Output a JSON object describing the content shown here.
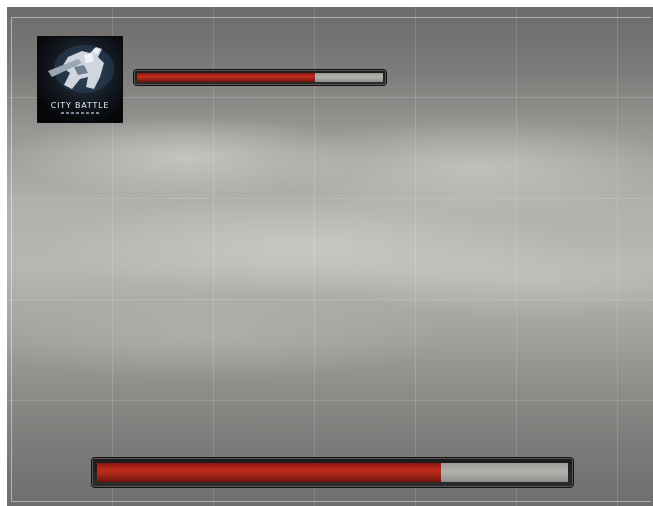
{
  "game": {
    "logo": {
      "title": "CITY BATTLE",
      "icon": "soldier-with-rifle-emblem"
    },
    "top_bar": {
      "name": "health",
      "fill_fraction": 0.725,
      "fill_color": "#b32618",
      "track_color": "#a8a6a2"
    },
    "bottom_bar": {
      "name": "loading-progress",
      "fill_fraction": 0.73,
      "fill_color": "#b32618",
      "track_color": "#a8a6a2"
    },
    "background": "overcast-sky-with-grid"
  }
}
